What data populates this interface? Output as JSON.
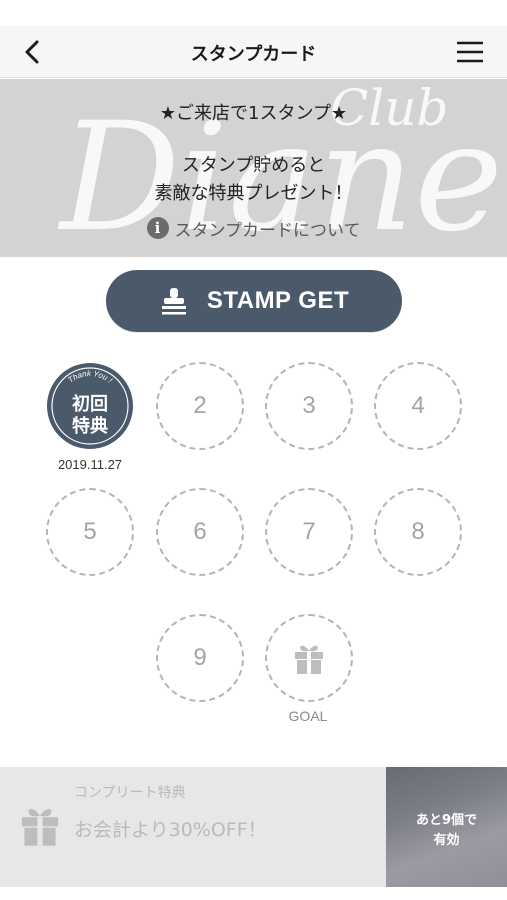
{
  "nav": {
    "title": "スタンプカード",
    "back_icon": "chevron-left-icon",
    "menu_icon": "hamburger-menu-icon"
  },
  "banner": {
    "logo_text": "Diane",
    "logo_sub": "Club",
    "line1": "★ご来店で1スタンプ★",
    "line2": "スタンプ貯めると",
    "line3": "素敵な特典プレゼント！",
    "about_link": "スタンプカードについて",
    "about_icon": "info-icon"
  },
  "stamp_button": {
    "label": "STAMP GET",
    "icon": "stamp-icon",
    "color": "#4a5a6a"
  },
  "stamps": {
    "first": {
      "ring_text": "Thank You !",
      "line1": "初回",
      "line2": "特典",
      "date": "2019.11.27"
    },
    "slots": [
      "2",
      "3",
      "4",
      "5",
      "6",
      "7",
      "8",
      "9"
    ],
    "goal_label": "GOAL",
    "goal_icon": "gift-icon"
  },
  "complete": {
    "subtitle": "コンプリート特典",
    "reward": "お会計より30%OFF！",
    "gift_icon": "gift-icon",
    "remaining_line1": "あと9個で",
    "remaining_line2": "有効"
  }
}
